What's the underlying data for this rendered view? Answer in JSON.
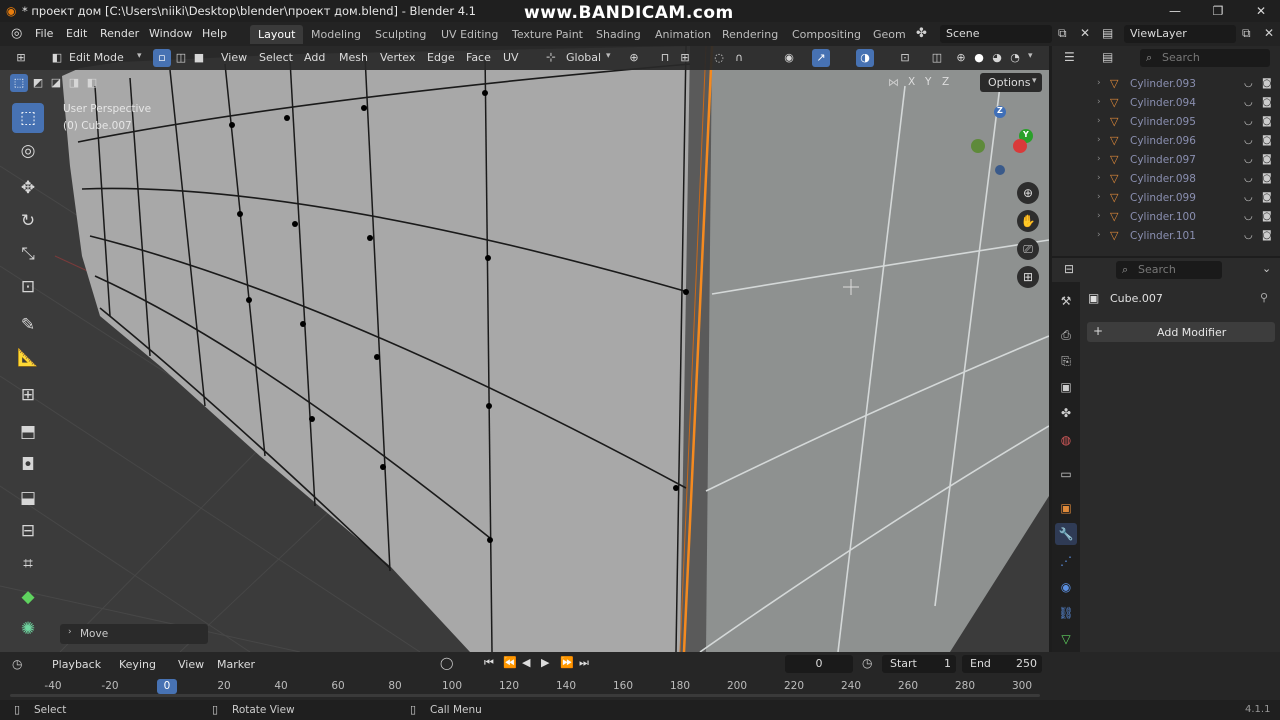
{
  "window": {
    "title": "* проект дом [C:\\Users\\niiki\\Desktop\\blender\\проект дом.blend] - Blender 4.1",
    "watermark": "www.BANDICAM.com",
    "minimize": "—",
    "restore": "❐",
    "close": "✕"
  },
  "menu": {
    "items": [
      "File",
      "Edit",
      "Render",
      "Window",
      "Help"
    ],
    "workspaces": [
      "Layout",
      "Modeling",
      "Sculpting",
      "UV Editing",
      "Texture Paint",
      "Shading",
      "Animation",
      "Rendering",
      "Compositing",
      "Geom"
    ],
    "active_workspace": "Layout",
    "scene": "Scene",
    "view_layer": "ViewLayer"
  },
  "viewport_header": {
    "mode": "Edit Mode",
    "menus": [
      "View",
      "Select",
      "Add",
      "Mesh",
      "Vertex",
      "Edge",
      "Face",
      "UV"
    ],
    "orientation": "Global",
    "axes": [
      "X",
      "Y",
      "Z"
    ],
    "options": "Options"
  },
  "viewport": {
    "perspective": "User Perspective",
    "object": "(0) Cube.007",
    "last_op": "Move",
    "gizmo_axes": [
      "Z",
      "Y"
    ]
  },
  "outliner": {
    "search_placeholder": "Search",
    "items": [
      "Cylinder.093",
      "Cylinder.094",
      "Cylinder.095",
      "Cylinder.096",
      "Cylinder.097",
      "Cylinder.098",
      "Cylinder.099",
      "Cylinder.100",
      "Cylinder.101"
    ]
  },
  "properties": {
    "search_placeholder": "Search",
    "object_name": "Cube.007",
    "add_modifier": "Add Modifier"
  },
  "timeline": {
    "menus": [
      "Playback",
      "Keying",
      "View",
      "Marker"
    ],
    "current_frame": "0",
    "start_label": "Start",
    "start": "1",
    "end_label": "End",
    "end": "250",
    "ruler": [
      "-40",
      "-20",
      "0",
      "20",
      "40",
      "60",
      "80",
      "100",
      "120",
      "140",
      "160",
      "180",
      "200",
      "220",
      "240",
      "260",
      "280",
      "300"
    ]
  },
  "statusbar": {
    "select": "Select",
    "rotate": "Rotate View",
    "call_menu": "Call Menu",
    "version": "4.1.1"
  }
}
